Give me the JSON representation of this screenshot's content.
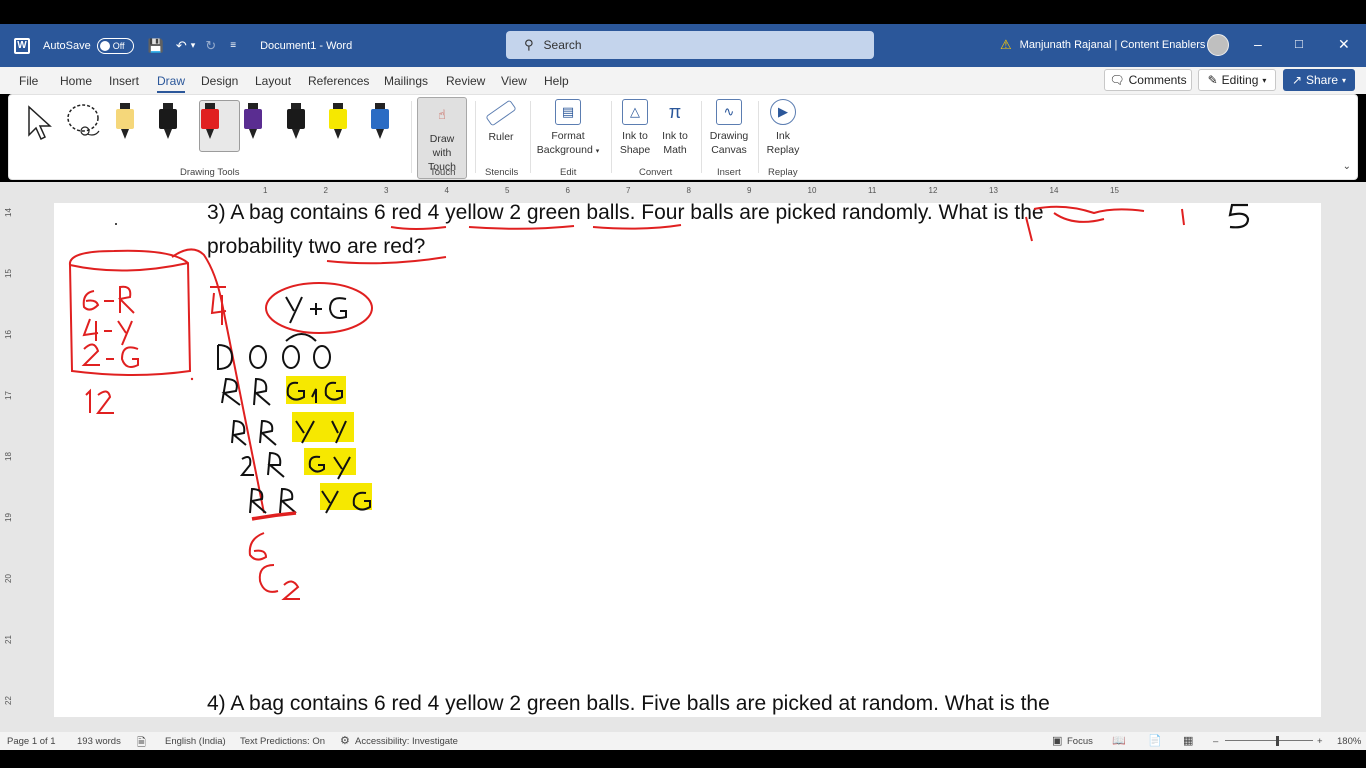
{
  "titlebar": {
    "autosave_label": "AutoSave",
    "autosave_state": "Off",
    "document_title": "Document1 - Word",
    "search_placeholder": "Search",
    "user": "Manjunath Rajanal | Content Enablers",
    "minimize": "–",
    "maximize": "□",
    "close": "✕"
  },
  "menu": {
    "items": [
      "File",
      "Home",
      "Insert",
      "Draw",
      "Design",
      "Layout",
      "References",
      "Mailings",
      "Review",
      "View",
      "Help"
    ],
    "active": "Draw",
    "comments": "Comments",
    "editing": "Editing",
    "share": "Share"
  },
  "ribbon": {
    "groups": {
      "drawing_tools": "Drawing Tools",
      "touch": "Touch",
      "stencils": "Stencils",
      "edit": "Edit",
      "convert": "Convert",
      "insert": "Insert",
      "replay": "Replay"
    },
    "buttons": {
      "draw_with_touch_1": "Draw with",
      "draw_with_touch_2": "Touch",
      "ruler": "Ruler",
      "format_bg_1": "Format",
      "format_bg_2": "Background",
      "ink_to_shape_1": "Ink to",
      "ink_to_shape_2": "Shape",
      "ink_to_math_1": "Ink to",
      "ink_to_math_2": "Math",
      "drawing_canvas_1": "Drawing",
      "drawing_canvas_2": "Canvas",
      "ink_replay_1": "Ink",
      "ink_replay_2": "Replay"
    },
    "pen_colors": [
      "#f5d77a",
      "#1a1a1a",
      "#e02020",
      "#5a2d91",
      "#1a1a1a",
      "#f6e800",
      "#2b6cc4"
    ]
  },
  "document": {
    "q3_line1": "3) A bag contains 6 red 4 yellow 2 green balls. Four balls are picked randomly. What is the",
    "q3_line2": "probability two are red?",
    "q4_line1": "4) A bag contains 6 red 4 yellow 2 green balls. Five balls are picked at random. What is the"
  },
  "status": {
    "page": "Page 1 of 1",
    "words": "193 words",
    "language": "English (India)",
    "text_predictions": "Text Predictions: On",
    "accessibility": "Accessibility: Investigate",
    "focus": "Focus",
    "zoom": "180%"
  },
  "hruler_ticks": [
    "1",
    "2",
    "3",
    "4",
    "5",
    "6",
    "7",
    "8",
    "9",
    "10",
    "11",
    "12",
    "13",
    "14",
    "15"
  ],
  "vruler_ticks": [
    "14",
    "15",
    "16",
    "17",
    "18",
    "19",
    "20",
    "21",
    "22"
  ]
}
